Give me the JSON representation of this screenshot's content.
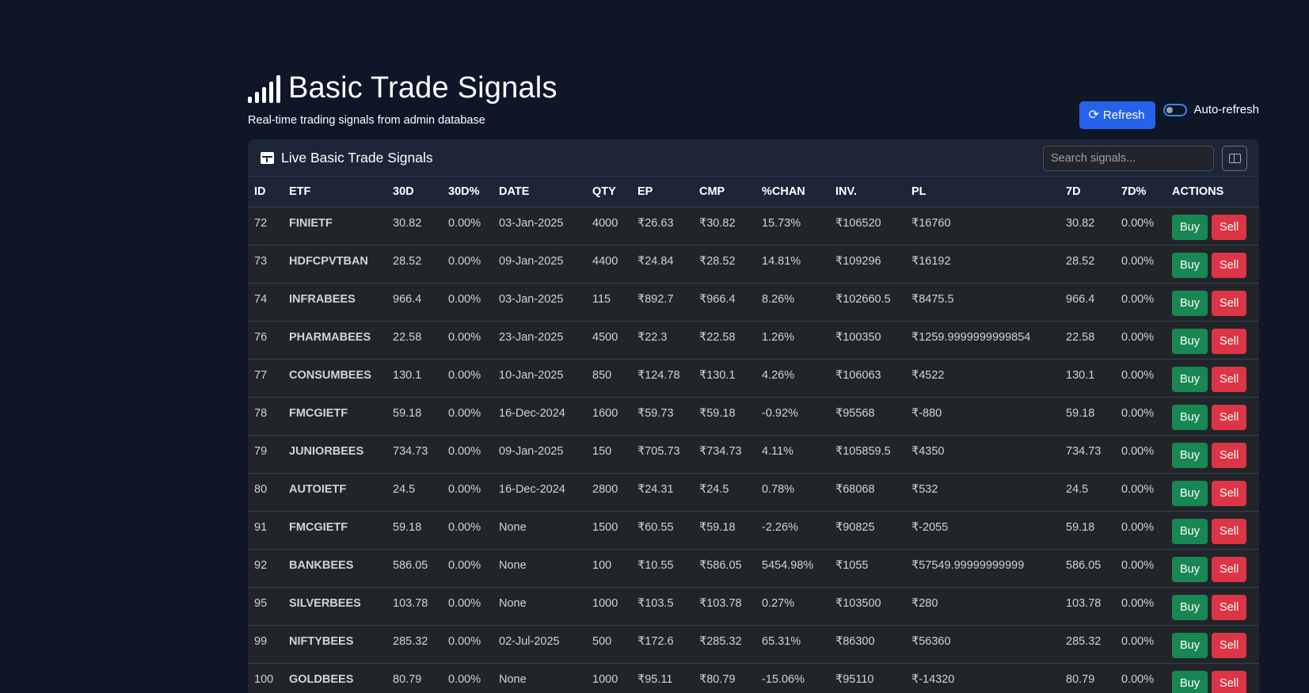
{
  "header": {
    "title": "Basic Trade Signals",
    "subtitle": "Real-time trading signals from admin database",
    "refresh_label": "Refresh",
    "autorefresh_label": "Auto-refresh",
    "autorefresh_on": false
  },
  "card": {
    "title": "Live Basic Trade Signals",
    "search_placeholder": "Search signals..."
  },
  "columns": [
    "ID",
    "ETF",
    "30D",
    "30D%",
    "DATE",
    "QTY",
    "EP",
    "CMP",
    "%CHAN",
    "INV.",
    "PL",
    "7D",
    "7D%",
    "ACTIONS"
  ],
  "buy_label": "Buy",
  "sell_label": "Sell",
  "rows": [
    [
      "72",
      "FINIETF",
      "30.82",
      "0.00%",
      "03-Jan-2025",
      "4000",
      "₹26.63",
      "₹30.82",
      "15.73%",
      "₹106520",
      "₹16760",
      "30.82",
      "0.00%"
    ],
    [
      "73",
      "HDFCPVTBAN",
      "28.52",
      "0.00%",
      "09-Jan-2025",
      "4400",
      "₹24.84",
      "₹28.52",
      "14.81%",
      "₹109296",
      "₹16192",
      "28.52",
      "0.00%"
    ],
    [
      "74",
      "INFRABEES",
      "966.4",
      "0.00%",
      "03-Jan-2025",
      "115",
      "₹892.7",
      "₹966.4",
      "8.26%",
      "₹102660.5",
      "₹8475.5",
      "966.4",
      "0.00%"
    ],
    [
      "76",
      "PHARMABEES",
      "22.58",
      "0.00%",
      "23-Jan-2025",
      "4500",
      "₹22.3",
      "₹22.58",
      "1.26%",
      "₹100350",
      "₹1259.9999999999854",
      "22.58",
      "0.00%"
    ],
    [
      "77",
      "CONSUMBEES",
      "130.1",
      "0.00%",
      "10-Jan-2025",
      "850",
      "₹124.78",
      "₹130.1",
      "4.26%",
      "₹106063",
      "₹4522",
      "130.1",
      "0.00%"
    ],
    [
      "78",
      "FMCGIETF",
      "59.18",
      "0.00%",
      "16-Dec-2024",
      "1600",
      "₹59.73",
      "₹59.18",
      "-0.92%",
      "₹95568",
      "₹-880",
      "59.18",
      "0.00%"
    ],
    [
      "79",
      "JUNIORBEES",
      "734.73",
      "0.00%",
      "09-Jan-2025",
      "150",
      "₹705.73",
      "₹734.73",
      "4.11%",
      "₹105859.5",
      "₹4350",
      "734.73",
      "0.00%"
    ],
    [
      "80",
      "AUTOIETF",
      "24.5",
      "0.00%",
      "16-Dec-2024",
      "2800",
      "₹24.31",
      "₹24.5",
      "0.78%",
      "₹68068",
      "₹532",
      "24.5",
      "0.00%"
    ],
    [
      "91",
      "FMCGIETF",
      "59.18",
      "0.00%",
      "None",
      "1500",
      "₹60.55",
      "₹59.18",
      "-2.26%",
      "₹90825",
      "₹-2055",
      "59.18",
      "0.00%"
    ],
    [
      "92",
      "BANKBEES",
      "586.05",
      "0.00%",
      "None",
      "100",
      "₹10.55",
      "₹586.05",
      "5454.98%",
      "₹1055",
      "₹57549.99999999999",
      "586.05",
      "0.00%"
    ],
    [
      "95",
      "SILVERBEES",
      "103.78",
      "0.00%",
      "None",
      "1000",
      "₹103.5",
      "₹103.78",
      "0.27%",
      "₹103500",
      "₹280",
      "103.78",
      "0.00%"
    ],
    [
      "99",
      "NIFTYBEES",
      "285.32",
      "0.00%",
      "02-Jul-2025",
      "500",
      "₹172.6",
      "₹285.32",
      "65.31%",
      "₹86300",
      "₹56360",
      "285.32",
      "0.00%"
    ],
    [
      "100",
      "GOLDBEES",
      "80.79",
      "0.00%",
      "None",
      "1000",
      "₹95.11",
      "₹80.79",
      "-15.06%",
      "₹95110",
      "₹-14320",
      "80.79",
      "0.00%"
    ]
  ],
  "colors": {
    "background": "#0e1628",
    "primary": "#2563eb",
    "buy": "#198754",
    "sell": "#dc3545"
  }
}
